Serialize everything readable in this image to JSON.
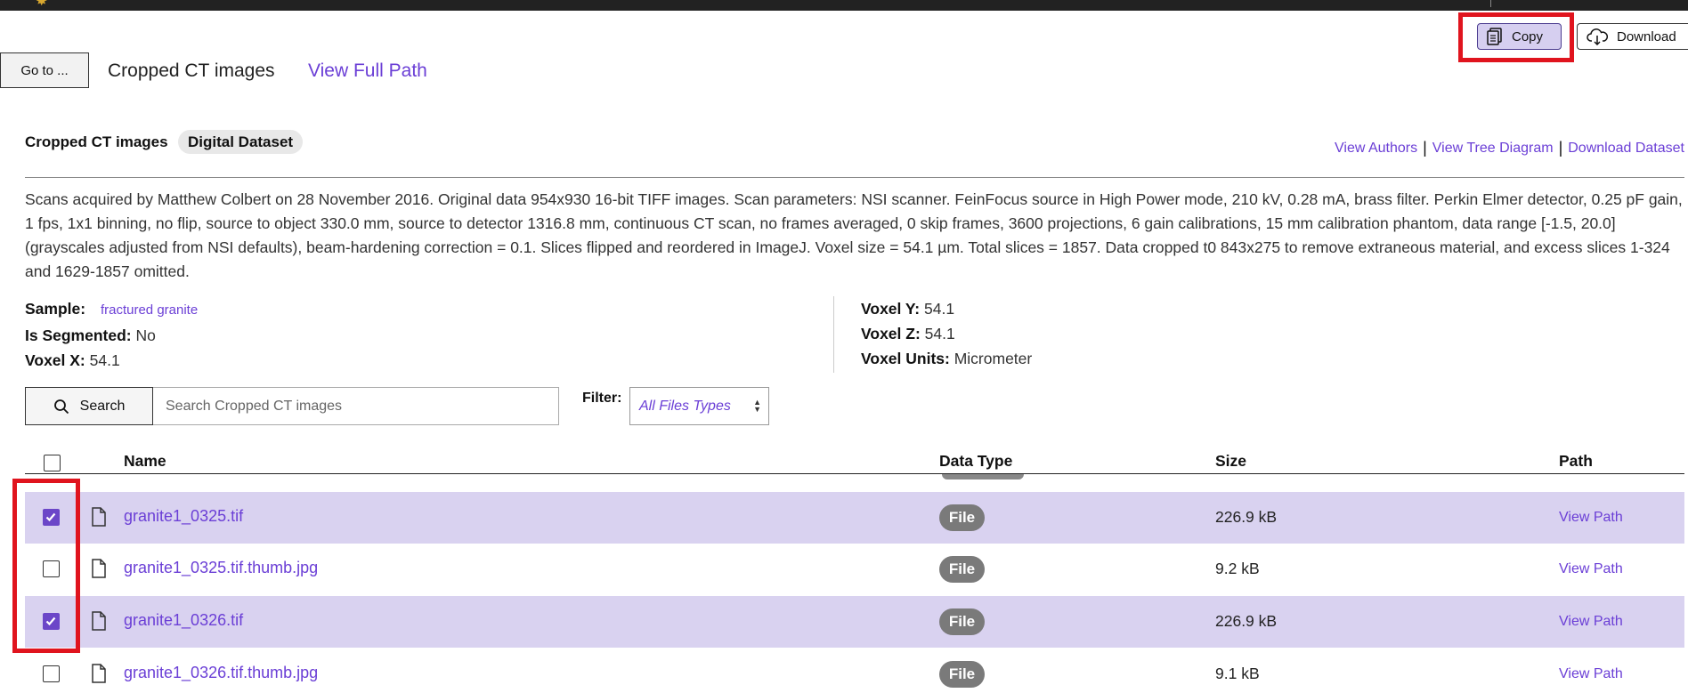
{
  "toolbar": {
    "copy_label": "Copy",
    "download_label": "Download"
  },
  "breadcrumb": {
    "goto_label": "Go to ...",
    "current": "Cropped CT images",
    "full_path_label": "View Full Path"
  },
  "dataset": {
    "title": "Cropped CT images",
    "badge": "Digital Dataset",
    "links": [
      "View Authors",
      "View Tree Diagram",
      "Download Dataset"
    ],
    "description": "Scans acquired by Matthew Colbert on 28 November 2016.  Original data 954x930 16-bit TIFF images. Scan parameters: NSI scanner. FeinFocus source in High Power mode, 210 kV, 0.28 mA, brass filter. Perkin Elmer detector, 0.25 pF gain, 1 fps, 1x1 binning, no flip, source to object 330.0 mm, source to detector 1316.8 mm, continuous CT scan, no frames averaged, 0 skip frames, 3600 projections, 6 gain calibrations, 15 mm calibration phantom, data range [-1.5, 20.0] (grayscales adjusted from NSI defaults), beam-hardening correction = 0.1. Slices flipped and reordered in ImageJ. Voxel size = 54.1 µm. Total slices = 1857.  Data cropped t0 843x275 to remove extraneous material, and excess slices 1-324 and 1629-1857 omitted."
  },
  "metadata": {
    "sample_label": "Sample:",
    "sample_value": "fractured granite",
    "segmented_label": "Is Segmented:",
    "segmented_value": "No",
    "voxel_x_label": "Voxel X:",
    "voxel_x_value": "54.1",
    "voxel_y_label": "Voxel Y:",
    "voxel_y_value": "54.1",
    "voxel_z_label": "Voxel Z:",
    "voxel_z_value": "54.1",
    "voxel_units_label": "Voxel Units:",
    "voxel_units_value": "Micrometer"
  },
  "search": {
    "button_label": "Search",
    "placeholder": "Search Cropped CT images",
    "filter_label": "Filter:",
    "filter_value": "All Files Types"
  },
  "table": {
    "columns": [
      "Name",
      "Data Type",
      "Size",
      "Path"
    ],
    "rows": [
      {
        "name": "granite1_0325.tif",
        "type": "File",
        "size": "226.9 kB",
        "path": "View Path",
        "selected": true
      },
      {
        "name": "granite1_0325.tif.thumb.jpg",
        "type": "File",
        "size": "9.2 kB",
        "path": "View Path",
        "selected": false
      },
      {
        "name": "granite1_0326.tif",
        "type": "File",
        "size": "226.9 kB",
        "path": "View Path",
        "selected": true
      },
      {
        "name": "granite1_0326.tif.thumb.jpg",
        "type": "File",
        "size": "9.1 kB",
        "path": "View Path",
        "selected": false
      }
    ]
  },
  "colors": {
    "accent": "#6b3fd6",
    "selected_row": "#d9d2f0",
    "highlight_box": "#e0141e",
    "badge_gray": "#7a7a7a"
  }
}
